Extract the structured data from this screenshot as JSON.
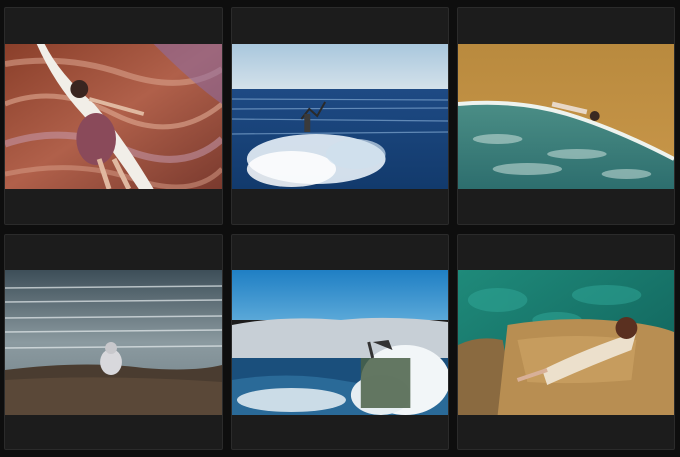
{
  "gallery": {
    "background": "#0e0e0e",
    "card_background": "#1c1c1c",
    "photos": [
      {
        "subject": "woman-on-striped-rock-with-white-fabric"
      },
      {
        "subject": "figure-in-crashing-waves"
      },
      {
        "subject": "woman-lying-at-sandy-shoreline"
      },
      {
        "subject": "person-sitting-on-rock-facing-sea"
      },
      {
        "subject": "figure-with-flag-on-rock-in-surf"
      },
      {
        "subject": "woman-lying-on-rock-by-turquoise-water"
      }
    ]
  }
}
